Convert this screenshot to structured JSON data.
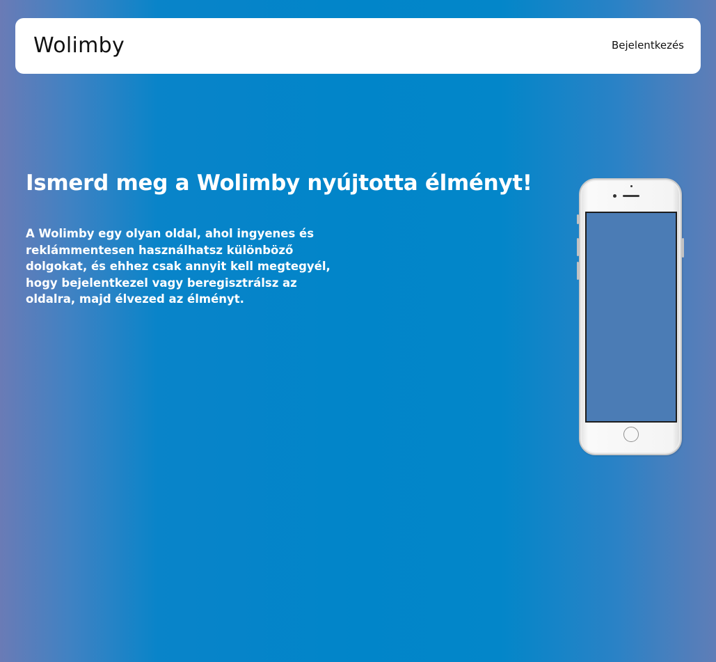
{
  "navbar": {
    "brand": "Wolimby",
    "login_label": "Bejelentkezés"
  },
  "hero": {
    "title": "Ismerd meg a Wolimby nyújtotta élményt!",
    "description": "A Wolimby egy olyan oldal, ahol ingyenes és reklámmentesen használhatsz különböző dolgokat, és ehhez csak annyit kell megtegyél, hogy bejelentkezel vagy beregisztrálsz az oldalra, majd élvezed az élményt."
  },
  "illustration": {
    "icon": "smartphone-icon"
  },
  "colors": {
    "background_center": "#0185c9",
    "background_edge": "#6a7bb6",
    "navbar_bg": "#ffffff",
    "phone_screen": "#4b7cb5"
  }
}
